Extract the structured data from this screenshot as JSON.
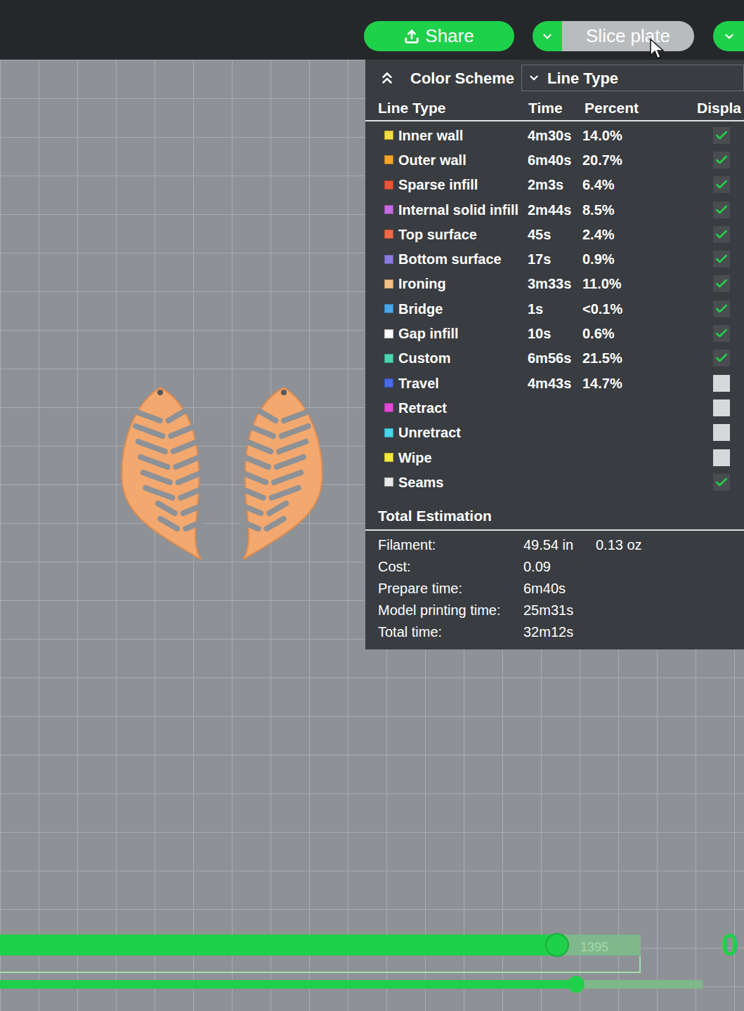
{
  "toolbar": {
    "share": "Share",
    "slice": "Slice plate"
  },
  "legend": {
    "title": "Color Scheme",
    "scheme": "Line Type",
    "columns": [
      "Line Type",
      "Time",
      "Percent",
      "Displa"
    ],
    "rows": [
      {
        "name": "Inner wall",
        "time": "4m30s",
        "percent": "14.0%",
        "color": "#f3dc3c",
        "displayed": true
      },
      {
        "name": "Outer wall",
        "time": "6m40s",
        "percent": "20.7%",
        "color": "#f4a629",
        "displayed": true
      },
      {
        "name": "Sparse infill",
        "time": "2m3s",
        "percent": "6.4%",
        "color": "#e8553a",
        "displayed": true
      },
      {
        "name": "Internal solid infill",
        "time": "2m44s",
        "percent": "8.5%",
        "color": "#c46be0",
        "displayed": true
      },
      {
        "name": "Top surface",
        "time": "45s",
        "percent": "2.4%",
        "color": "#f06a4a",
        "displayed": true
      },
      {
        "name": "Bottom surface",
        "time": "17s",
        "percent": "0.9%",
        "color": "#8a7de0",
        "displayed": true
      },
      {
        "name": "Ironing",
        "time": "3m33s",
        "percent": "11.0%",
        "color": "#f2c184",
        "displayed": true
      },
      {
        "name": "Bridge",
        "time": "1s",
        "percent": "<0.1%",
        "color": "#4aa8e8",
        "displayed": true
      },
      {
        "name": "Gap infill",
        "time": "10s",
        "percent": "0.6%",
        "color": "#ffffff",
        "displayed": true
      },
      {
        "name": "Custom",
        "time": "6m56s",
        "percent": "21.5%",
        "color": "#4ad6b0",
        "displayed": true
      },
      {
        "name": "Travel",
        "time": "4m43s",
        "percent": "14.7%",
        "color": "#4a6ae8",
        "displayed": false
      },
      {
        "name": "Retract",
        "time": "",
        "percent": "",
        "color": "#e04ad6",
        "displayed": false
      },
      {
        "name": "Unretract",
        "time": "",
        "percent": "",
        "color": "#4ad6ea",
        "displayed": false
      },
      {
        "name": "Wipe",
        "time": "",
        "percent": "",
        "color": "#f3e83c",
        "displayed": false
      },
      {
        "name": "Seams",
        "time": "",
        "percent": "",
        "color": "#e8e8e8",
        "displayed": true
      }
    ],
    "total_title": "Total Estimation",
    "totals": [
      {
        "label": "Filament:",
        "value": "49.54 in",
        "extra": "0.13 oz"
      },
      {
        "label": "Cost:",
        "value": "0.09",
        "extra": ""
      },
      {
        "label": "Prepare time:",
        "value": "6m40s",
        "extra": ""
      },
      {
        "label": "Model printing time:",
        "value": "25m31s",
        "extra": ""
      },
      {
        "label": "Total time:",
        "value": "32m12s",
        "extra": ""
      }
    ]
  },
  "layer_slider": {
    "level": 0.87,
    "label": "1395"
  },
  "move_slider": {
    "level": 0.82
  },
  "layer_number": "0"
}
